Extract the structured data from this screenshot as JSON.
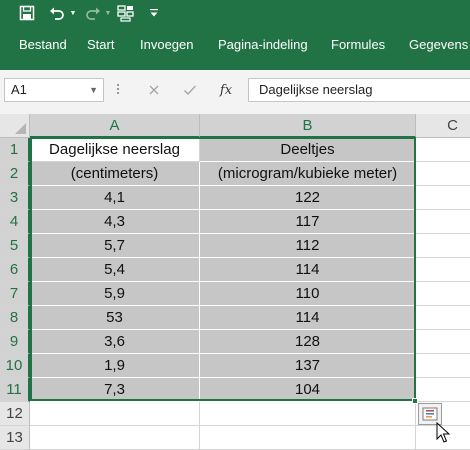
{
  "quick_access": {
    "save_icon": "save-icon",
    "undo_icon": "undo-icon",
    "redo_icon": "redo-icon",
    "form_icon": "form-icon",
    "customize_icon": "customize-qat-icon"
  },
  "ribbon": {
    "tabs": [
      "Bestand",
      "Start",
      "Invoegen",
      "Pagina-indeling",
      "Formules",
      "Gegevens"
    ]
  },
  "formula_bar": {
    "name_box": "A1",
    "cancel_icon": "cancel-icon",
    "enter_icon": "enter-check-icon",
    "fx_label": "fx",
    "content": "Dagelijkse neerslag"
  },
  "sheet": {
    "columns": [
      "A",
      "B",
      "C"
    ],
    "row_numbers": [
      "1",
      "2",
      "3",
      "4",
      "5",
      "6",
      "7",
      "8",
      "9",
      "10",
      "11",
      "12",
      "13"
    ],
    "rows": [
      [
        "Dagelijkse neerslag",
        "Deeltjes"
      ],
      [
        "(centimeters)",
        "(microgram/kubieke meter)"
      ],
      [
        "4,1",
        "122"
      ],
      [
        "4,3",
        "117"
      ],
      [
        "5,7",
        "112"
      ],
      [
        "5,4",
        "114"
      ],
      [
        "5,9",
        "110"
      ],
      [
        "53",
        "114"
      ],
      [
        "3,6",
        "128"
      ],
      [
        "1,9",
        "137"
      ],
      [
        "7,3",
        "104"
      ]
    ],
    "active_cell": "A1",
    "selection": "A1:B11"
  },
  "colors": {
    "accent": "#217346",
    "selection_shade": "#c6c6c6"
  },
  "quick_analysis_icon": "quick-analysis-icon",
  "cursor_icon": "pointer-cursor-icon"
}
